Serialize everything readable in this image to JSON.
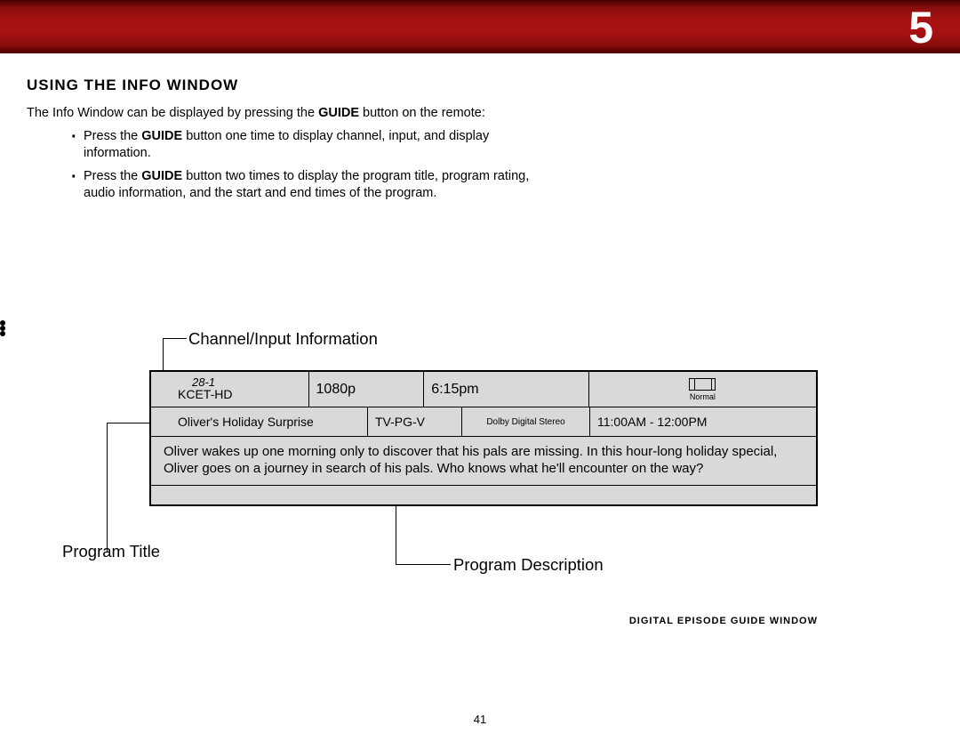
{
  "header": {
    "chapter_number": "5"
  },
  "section": {
    "heading": "USING THE INFO WINDOW",
    "intro_pre": "The Info Window can be displayed by pressing the ",
    "intro_guide": "GUIDE",
    "intro_post": " button on the remote:",
    "b1_pre": "Press the ",
    "b1_guide": "GUIDE",
    "b1_post": " button one time to display channel, input, and display information.",
    "b2_pre": "Press the ",
    "b2_guide": "GUIDE",
    "b2_post": " button two times to display the program title, program rating, audio information, and the start and end times of the program."
  },
  "callouts": {
    "channel_input": "Channel/Input Information",
    "program_title": "Program Title",
    "program_description": "Program Description"
  },
  "info": {
    "channel_number": "28-1",
    "channel_callsign": "KCET-HD",
    "resolution": "1080p",
    "time": "6:15pm",
    "aspect_label": "Normal",
    "program_title": "Oliver's Holiday Surprise",
    "rating": "TV-PG-V",
    "audio": "Dolby Digital Stereo",
    "timespan": "11:00AM - 12:00PM",
    "description": "Oliver wakes up one morning only to discover that his pals are missing. In this hour-long holiday special, Oliver goes on a journey in search of his pals. Who knows what he'll encounter on the way?"
  },
  "diagram_caption": "DIGITAL EPISODE GUIDE WINDOW",
  "page_number": "41"
}
